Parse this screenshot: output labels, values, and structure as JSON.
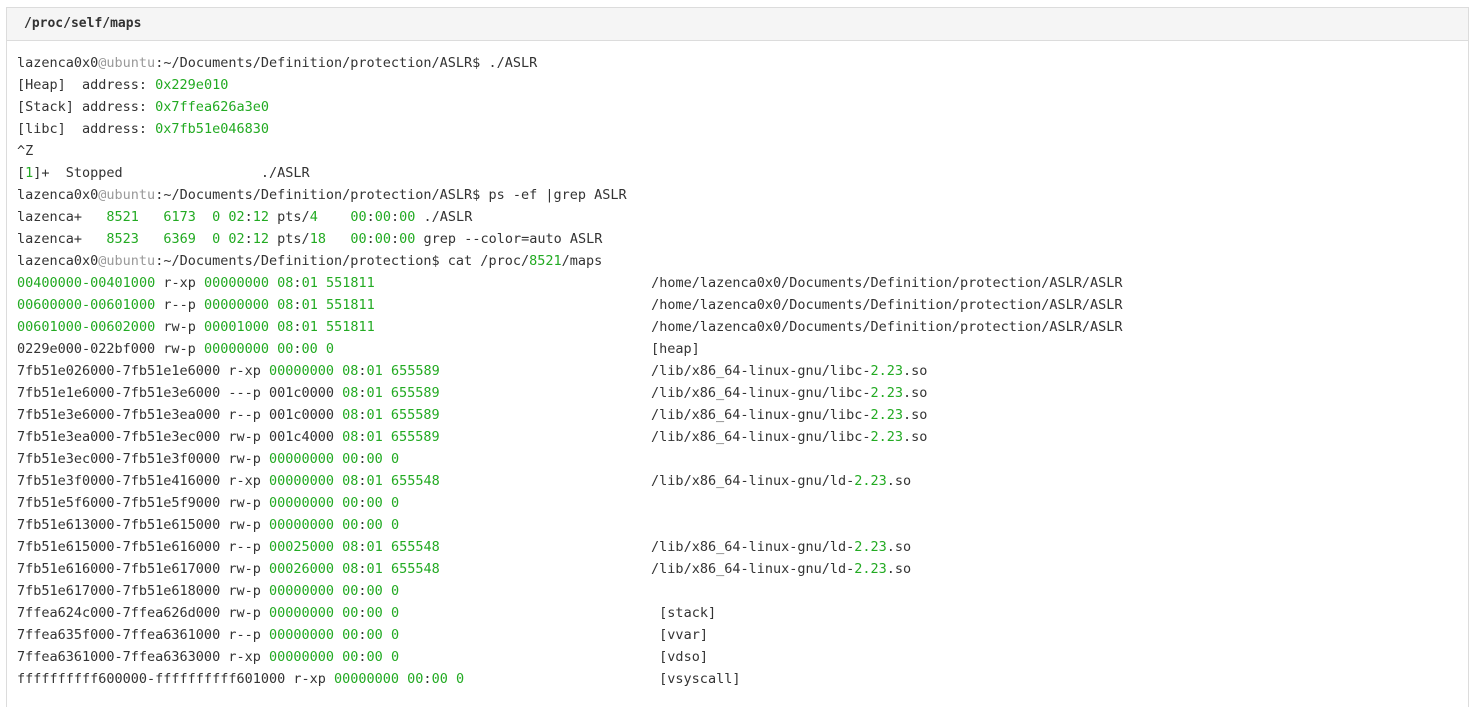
{
  "header": {
    "title": "/proc/self/maps"
  },
  "colors": {
    "number": "#22aa22",
    "host_separator": "#999999",
    "text": "#333333",
    "header_bg": "#f5f5f5",
    "border": "#dcdcdc"
  },
  "lines": [
    [
      {
        "t": "lazenca0x0"
      },
      {
        "t": "@",
        "c": "h"
      },
      {
        "t": "ubuntu",
        "c": "h"
      },
      {
        "t": ":~/Documents/Definition/protection/ASLR$ ./ASLR"
      }
    ],
    [
      {
        "t": "[Heap]  address: "
      },
      {
        "t": "0x229e010",
        "c": "g"
      }
    ],
    [
      {
        "t": "[Stack] address: "
      },
      {
        "t": "0x7ffea626a3e0",
        "c": "g"
      }
    ],
    [
      {
        "t": "[libc]  address: "
      },
      {
        "t": "0x7fb51e046830",
        "c": "g"
      }
    ],
    [
      {
        "t": "^Z"
      }
    ],
    [
      {
        "t": "["
      },
      {
        "t": "1",
        "c": "g"
      },
      {
        "t": "]+  Stopped                 ./ASLR"
      }
    ],
    [
      {
        "t": "lazenca0x0"
      },
      {
        "t": "@",
        "c": "h"
      },
      {
        "t": "ubuntu",
        "c": "h"
      },
      {
        "t": ":~/Documents/Definition/protection/ASLR$ ps -ef |grep ASLR"
      }
    ],
    [
      {
        "t": "lazenca+   "
      },
      {
        "t": "8521",
        "c": "g"
      },
      {
        "t": "   "
      },
      {
        "t": "6173",
        "c": "g"
      },
      {
        "t": "  "
      },
      {
        "t": "0",
        "c": "g"
      },
      {
        "t": " "
      },
      {
        "t": "02",
        "c": "g"
      },
      {
        "t": ":"
      },
      {
        "t": "12",
        "c": "g"
      },
      {
        "t": " pts/"
      },
      {
        "t": "4",
        "c": "g"
      },
      {
        "t": "    "
      },
      {
        "t": "00",
        "c": "g"
      },
      {
        "t": ":"
      },
      {
        "t": "00",
        "c": "g"
      },
      {
        "t": ":"
      },
      {
        "t": "00",
        "c": "g"
      },
      {
        "t": " ./ASLR"
      }
    ],
    [
      {
        "t": "lazenca+   "
      },
      {
        "t": "8523",
        "c": "g"
      },
      {
        "t": "   "
      },
      {
        "t": "6369",
        "c": "g"
      },
      {
        "t": "  "
      },
      {
        "t": "0",
        "c": "g"
      },
      {
        "t": " "
      },
      {
        "t": "02",
        "c": "g"
      },
      {
        "t": ":"
      },
      {
        "t": "12",
        "c": "g"
      },
      {
        "t": " pts/"
      },
      {
        "t": "18",
        "c": "g"
      },
      {
        "t": "   "
      },
      {
        "t": "00",
        "c": "g"
      },
      {
        "t": ":"
      },
      {
        "t": "00",
        "c": "g"
      },
      {
        "t": ":"
      },
      {
        "t": "00",
        "c": "g"
      },
      {
        "t": " grep --color=auto ASLR"
      }
    ],
    [
      {
        "t": "lazenca0x0"
      },
      {
        "t": "@",
        "c": "h"
      },
      {
        "t": "ubuntu",
        "c": "h"
      },
      {
        "t": ":~/Documents/Definition/protection$ cat /proc/"
      },
      {
        "t": "8521",
        "c": "g"
      },
      {
        "t": "/maps"
      }
    ],
    [
      {
        "t": "00400000",
        "c": "g"
      },
      {
        "t": "-",
        "c": "g"
      },
      {
        "t": "00401000",
        "c": "g"
      },
      {
        "t": " r-xp "
      },
      {
        "t": "00000000",
        "c": "g"
      },
      {
        "t": " "
      },
      {
        "t": "08",
        "c": "g"
      },
      {
        "t": ":"
      },
      {
        "t": "01",
        "c": "g"
      },
      {
        "t": " "
      },
      {
        "t": "551811",
        "c": "g"
      },
      {
        "t": "                                  /home/lazenca0x0/Documents/Definition/protection/ASLR/ASLR"
      }
    ],
    [
      {
        "t": "00600000",
        "c": "g"
      },
      {
        "t": "-",
        "c": "g"
      },
      {
        "t": "00601000",
        "c": "g"
      },
      {
        "t": " r--p "
      },
      {
        "t": "00000000",
        "c": "g"
      },
      {
        "t": " "
      },
      {
        "t": "08",
        "c": "g"
      },
      {
        "t": ":"
      },
      {
        "t": "01",
        "c": "g"
      },
      {
        "t": " "
      },
      {
        "t": "551811",
        "c": "g"
      },
      {
        "t": "                                  /home/lazenca0x0/Documents/Definition/protection/ASLR/ASLR"
      }
    ],
    [
      {
        "t": "00601000",
        "c": "g"
      },
      {
        "t": "-",
        "c": "g"
      },
      {
        "t": "00602000",
        "c": "g"
      },
      {
        "t": " rw-p "
      },
      {
        "t": "00001000",
        "c": "g"
      },
      {
        "t": " "
      },
      {
        "t": "08",
        "c": "g"
      },
      {
        "t": ":"
      },
      {
        "t": "01",
        "c": "g"
      },
      {
        "t": " "
      },
      {
        "t": "551811",
        "c": "g"
      },
      {
        "t": "                                  /home/lazenca0x0/Documents/Definition/protection/ASLR/ASLR"
      }
    ],
    [
      {
        "t": "0229e000-022bf000 rw-p "
      },
      {
        "t": "00000000",
        "c": "g"
      },
      {
        "t": " "
      },
      {
        "t": "00",
        "c": "g"
      },
      {
        "t": ":"
      },
      {
        "t": "00",
        "c": "g"
      },
      {
        "t": " "
      },
      {
        "t": "0",
        "c": "g"
      },
      {
        "t": "                                       [heap]"
      }
    ],
    [
      {
        "t": "7fb51e026000-7fb51e1e6000 r-xp "
      },
      {
        "t": "00000000",
        "c": "g"
      },
      {
        "t": " "
      },
      {
        "t": "08",
        "c": "g"
      },
      {
        "t": ":"
      },
      {
        "t": "01",
        "c": "g"
      },
      {
        "t": " "
      },
      {
        "t": "655589",
        "c": "g"
      },
      {
        "t": "                          /lib/x86_64-linux-gnu/libc-"
      },
      {
        "t": "2.23",
        "c": "g"
      },
      {
        "t": ".so"
      }
    ],
    [
      {
        "t": "7fb51e1e6000-7fb51e3e6000 ---p 001c0000 "
      },
      {
        "t": "08",
        "c": "g"
      },
      {
        "t": ":"
      },
      {
        "t": "01",
        "c": "g"
      },
      {
        "t": " "
      },
      {
        "t": "655589",
        "c": "g"
      },
      {
        "t": "                          /lib/x86_64-linux-gnu/libc-"
      },
      {
        "t": "2.23",
        "c": "g"
      },
      {
        "t": ".so"
      }
    ],
    [
      {
        "t": "7fb51e3e6000-7fb51e3ea000 r--p 001c0000 "
      },
      {
        "t": "08",
        "c": "g"
      },
      {
        "t": ":"
      },
      {
        "t": "01",
        "c": "g"
      },
      {
        "t": " "
      },
      {
        "t": "655589",
        "c": "g"
      },
      {
        "t": "                          /lib/x86_64-linux-gnu/libc-"
      },
      {
        "t": "2.23",
        "c": "g"
      },
      {
        "t": ".so"
      }
    ],
    [
      {
        "t": "7fb51e3ea000-7fb51e3ec000 rw-p 001c4000 "
      },
      {
        "t": "08",
        "c": "g"
      },
      {
        "t": ":"
      },
      {
        "t": "01",
        "c": "g"
      },
      {
        "t": " "
      },
      {
        "t": "655589",
        "c": "g"
      },
      {
        "t": "                          /lib/x86_64-linux-gnu/libc-"
      },
      {
        "t": "2.23",
        "c": "g"
      },
      {
        "t": ".so"
      }
    ],
    [
      {
        "t": "7fb51e3ec000-7fb51e3f0000 rw-p "
      },
      {
        "t": "00000000",
        "c": "g"
      },
      {
        "t": " "
      },
      {
        "t": "00",
        "c": "g"
      },
      {
        "t": ":"
      },
      {
        "t": "00",
        "c": "g"
      },
      {
        "t": " "
      },
      {
        "t": "0",
        "c": "g"
      }
    ],
    [
      {
        "t": "7fb51e3f0000-7fb51e416000 r-xp "
      },
      {
        "t": "00000000",
        "c": "g"
      },
      {
        "t": " "
      },
      {
        "t": "08",
        "c": "g"
      },
      {
        "t": ":"
      },
      {
        "t": "01",
        "c": "g"
      },
      {
        "t": " "
      },
      {
        "t": "655548",
        "c": "g"
      },
      {
        "t": "                          /lib/x86_64-linux-gnu/ld-"
      },
      {
        "t": "2.23",
        "c": "g"
      },
      {
        "t": ".so"
      }
    ],
    [
      {
        "t": "7fb51e5f6000-7fb51e5f9000 rw-p "
      },
      {
        "t": "00000000",
        "c": "g"
      },
      {
        "t": " "
      },
      {
        "t": "00",
        "c": "g"
      },
      {
        "t": ":"
      },
      {
        "t": "00",
        "c": "g"
      },
      {
        "t": " "
      },
      {
        "t": "0",
        "c": "g"
      }
    ],
    [
      {
        "t": "7fb51e613000-7fb51e615000 rw-p "
      },
      {
        "t": "00000000",
        "c": "g"
      },
      {
        "t": " "
      },
      {
        "t": "00",
        "c": "g"
      },
      {
        "t": ":"
      },
      {
        "t": "00",
        "c": "g"
      },
      {
        "t": " "
      },
      {
        "t": "0",
        "c": "g"
      }
    ],
    [
      {
        "t": "7fb51e615000-7fb51e616000 r--p "
      },
      {
        "t": "00025000",
        "c": "g"
      },
      {
        "t": " "
      },
      {
        "t": "08",
        "c": "g"
      },
      {
        "t": ":"
      },
      {
        "t": "01",
        "c": "g"
      },
      {
        "t": " "
      },
      {
        "t": "655548",
        "c": "g"
      },
      {
        "t": "                          /lib/x86_64-linux-gnu/ld-"
      },
      {
        "t": "2.23",
        "c": "g"
      },
      {
        "t": ".so"
      }
    ],
    [
      {
        "t": "7fb51e616000-7fb51e617000 rw-p "
      },
      {
        "t": "00026000",
        "c": "g"
      },
      {
        "t": " "
      },
      {
        "t": "08",
        "c": "g"
      },
      {
        "t": ":"
      },
      {
        "t": "01",
        "c": "g"
      },
      {
        "t": " "
      },
      {
        "t": "655548",
        "c": "g"
      },
      {
        "t": "                          /lib/x86_64-linux-gnu/ld-"
      },
      {
        "t": "2.23",
        "c": "g"
      },
      {
        "t": ".so"
      }
    ],
    [
      {
        "t": "7fb51e617000-7fb51e618000 rw-p "
      },
      {
        "t": "00000000",
        "c": "g"
      },
      {
        "t": " "
      },
      {
        "t": "00",
        "c": "g"
      },
      {
        "t": ":"
      },
      {
        "t": "00",
        "c": "g"
      },
      {
        "t": " "
      },
      {
        "t": "0",
        "c": "g"
      }
    ],
    [
      {
        "t": "7ffea624c000-7ffea626d000 rw-p "
      },
      {
        "t": "00000000",
        "c": "g"
      },
      {
        "t": " "
      },
      {
        "t": "00",
        "c": "g"
      },
      {
        "t": ":"
      },
      {
        "t": "00",
        "c": "g"
      },
      {
        "t": " "
      },
      {
        "t": "0",
        "c": "g"
      },
      {
        "t": "                                [stack]"
      }
    ],
    [
      {
        "t": "7ffea635f000-7ffea6361000 r--p "
      },
      {
        "t": "00000000",
        "c": "g"
      },
      {
        "t": " "
      },
      {
        "t": "00",
        "c": "g"
      },
      {
        "t": ":"
      },
      {
        "t": "00",
        "c": "g"
      },
      {
        "t": " "
      },
      {
        "t": "0",
        "c": "g"
      },
      {
        "t": "                                [vvar]"
      }
    ],
    [
      {
        "t": "7ffea6361000-7ffea6363000 r-xp "
      },
      {
        "t": "00000000",
        "c": "g"
      },
      {
        "t": " "
      },
      {
        "t": "00",
        "c": "g"
      },
      {
        "t": ":"
      },
      {
        "t": "00",
        "c": "g"
      },
      {
        "t": " "
      },
      {
        "t": "0",
        "c": "g"
      },
      {
        "t": "                                [vdso]"
      }
    ],
    [
      {
        "t": "ffffffffff600000-ffffffffff601000 r-xp "
      },
      {
        "t": "00000000",
        "c": "g"
      },
      {
        "t": " "
      },
      {
        "t": "00",
        "c": "g"
      },
      {
        "t": ":"
      },
      {
        "t": "00",
        "c": "g"
      },
      {
        "t": " "
      },
      {
        "t": "0",
        "c": "g"
      },
      {
        "t": "                        [vsyscall]"
      }
    ]
  ]
}
